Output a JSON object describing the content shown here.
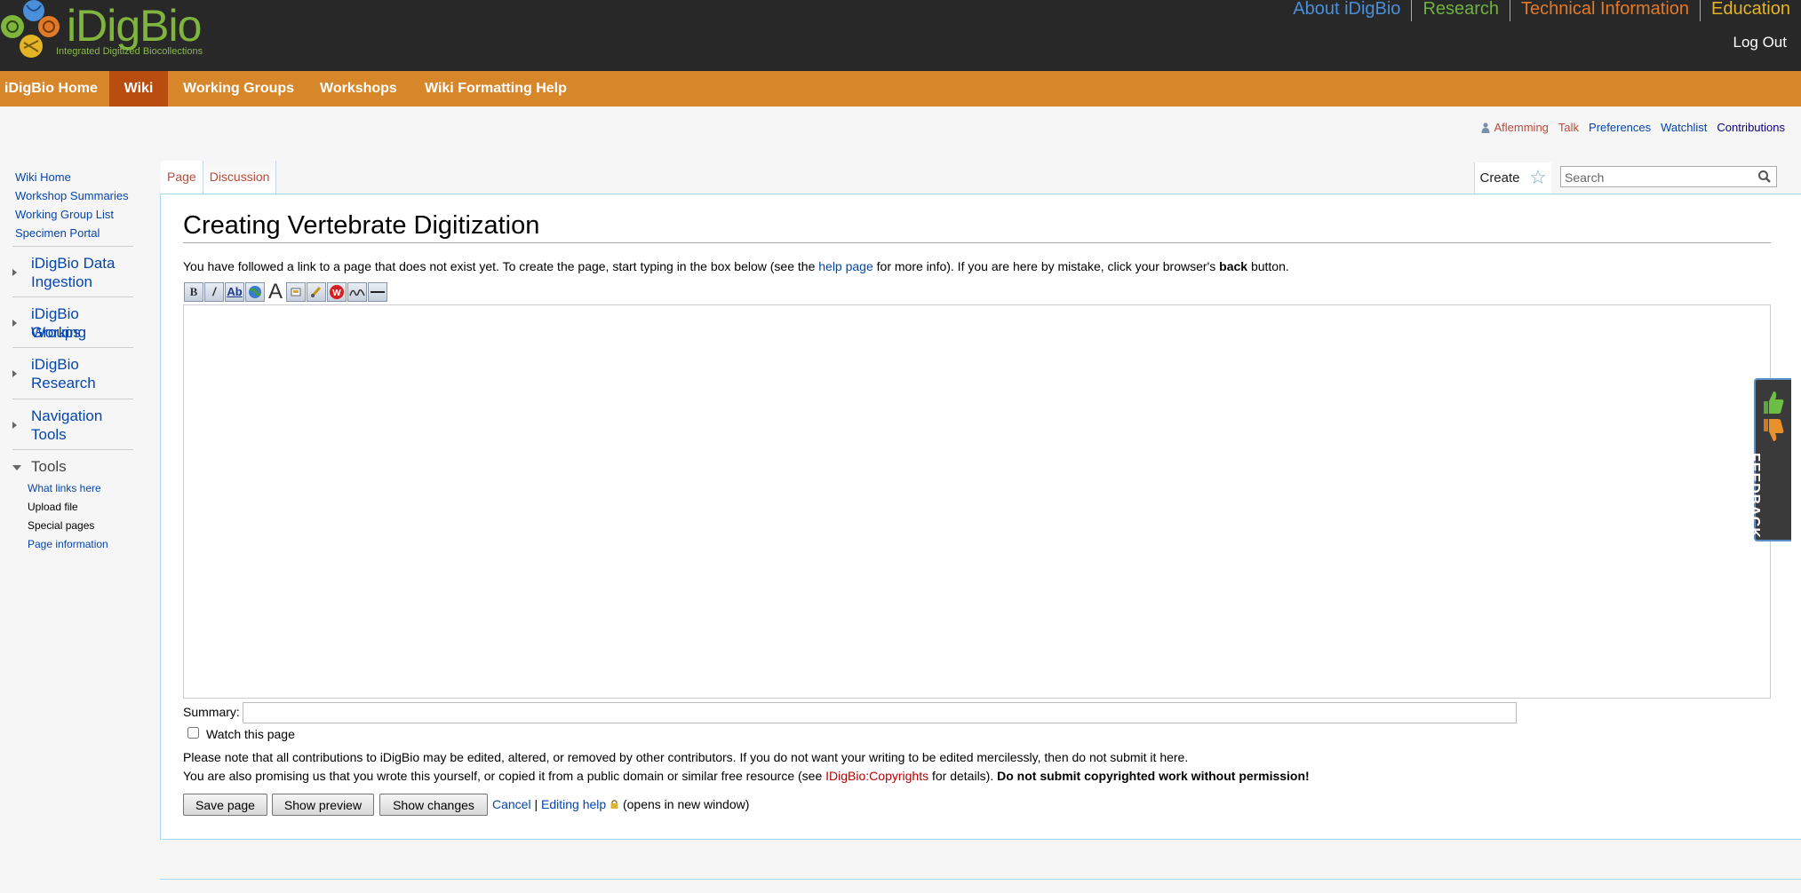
{
  "header": {
    "logo_text": "iDigBio",
    "logo_tagline": "Integrated Digitized Biocollections",
    "top_links": [
      {
        "label": "About iDigBio",
        "color": "#4a8fd9"
      },
      {
        "label": "Research",
        "color": "#6fb040"
      },
      {
        "label": "Technical Information",
        "color": "#e07a2a"
      },
      {
        "label": "Education",
        "color": "#e2b426"
      }
    ],
    "logout": "Log Out"
  },
  "menu": {
    "items": [
      "iDigBio Home",
      "Wiki",
      "Working Groups",
      "Workshops",
      "Wiki Formatting Help"
    ],
    "active": "Wiki",
    "bar_color": "#d8862a",
    "active_color": "#b94d0f"
  },
  "personal_tools": {
    "user": "Aflemming",
    "talk": "Talk",
    "preferences": "Preferences",
    "watchlist": "Watchlist",
    "contributions": "Contributions"
  },
  "sidebar": {
    "links": [
      "Wiki Home",
      "Workshop Summaries",
      "Working Group List",
      "Specimen Portal"
    ],
    "portals": [
      {
        "line1": "iDigBio Data",
        "line2": "Ingestion"
      },
      {
        "line1": "iDigBio Working",
        "line2": "Groups"
      },
      {
        "line1": "iDigBio",
        "line2": "Research"
      },
      {
        "line1": "Navigation",
        "line2": "Tools"
      }
    ],
    "tools_heading": "Tools",
    "tools": [
      "What links here",
      "Upload file",
      "Special pages",
      "Page information"
    ]
  },
  "tabs": {
    "page": "Page",
    "discussion": "Discussion",
    "create": "Create",
    "search_placeholder": "Search"
  },
  "content": {
    "title": "Creating Vertebrate Digitization",
    "intro_before": "You have followed a link to a page that does not exist yet. To create the page, start typing in the box below (see the ",
    "intro_link": "help page",
    "intro_middle": " for more info). If you are here by mistake, click your browser's ",
    "intro_bold": "back",
    "intro_after": " button.",
    "summary_label": "Summary:",
    "watch_label": "Watch this page",
    "notice1": "Please note that all contributions to iDigBio may be edited, altered, or removed by other contributors. If you do not want your writing to be edited mercilessly, then do not submit it here.",
    "notice2_before": "You are also promising us that you wrote this yourself, or copied it from a public domain or similar free resource (see ",
    "notice2_link": "IDigBio:Copyrights",
    "notice2_middle": " for details). ",
    "notice2_bold": "Do not submit copyrighted work without permission!",
    "buttons": {
      "save": "Save page",
      "preview": "Show preview",
      "changes": "Show changes"
    },
    "cancel": "Cancel",
    "separator": "|",
    "editing_help": "Editing help",
    "new_window": "(opens in new window)"
  },
  "feedback": "FEEDBACK"
}
